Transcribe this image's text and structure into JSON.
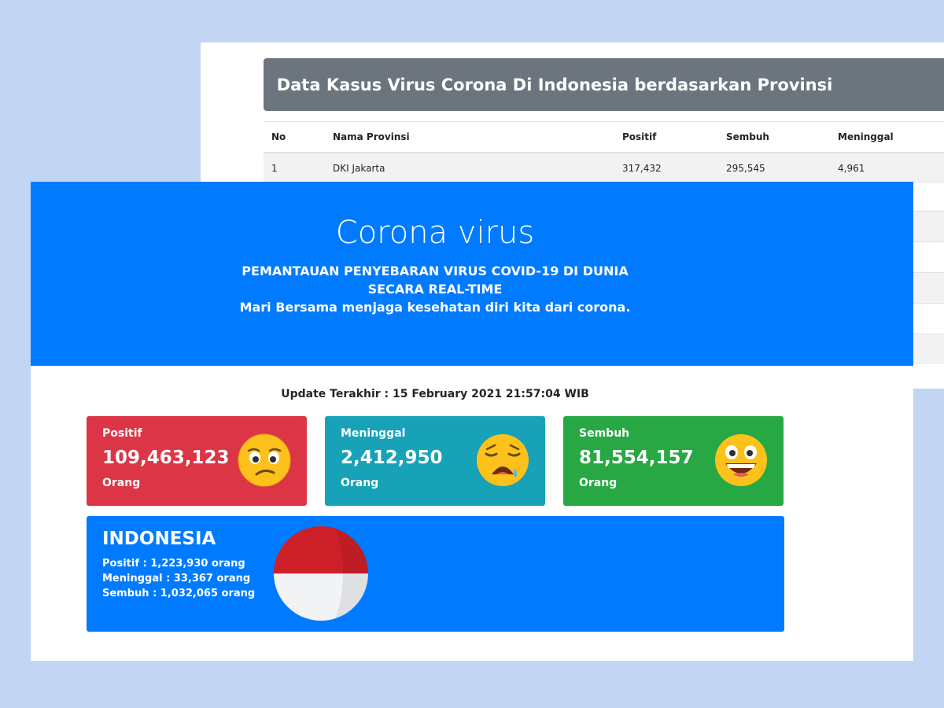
{
  "table_window": {
    "heading": "Data Kasus Virus Corona Di Indonesia berdasarkan Provinsi",
    "columns": [
      "No",
      "Nama Provinsi",
      "Positif",
      "Sembuh",
      "Meninggal"
    ],
    "rows": [
      [
        "1",
        "DKI Jakarta",
        "317,432",
        "295,545",
        "4,961"
      ]
    ]
  },
  "hero": {
    "title": "Corona virus",
    "subtitle_line1": "PEMANTAUAN PENYEBARAN VIRUS COVID-19 DI DUNIA",
    "subtitle_line2": "SECARA REAL-TIME",
    "subtitle_line3": "Mari Bersama menjaga kesehatan diri kita dari corona."
  },
  "update": "Update Terakhir : 15 February 2021 21:57:04 WIB",
  "cards": [
    {
      "label": "Positif",
      "value": "109,463,123",
      "unit": "Orang",
      "color": "#dc3545",
      "icon": "worried-face-icon"
    },
    {
      "label": "Meninggal",
      "value": "2,412,950",
      "unit": "Orang",
      "color": "#17a2b8",
      "icon": "crying-face-icon"
    },
    {
      "label": "Sembuh",
      "value": "81,554,157",
      "unit": "Orang",
      "color": "#28a745",
      "icon": "grinning-face-icon"
    }
  ],
  "indonesia": {
    "title": "INDONESIA",
    "positif": "Positif : 1,223,930 orang",
    "meninggal": "Meninggal : 33,367 orang",
    "sembuh": "Sembuh : 1,032,065 orang",
    "color": "#007bff",
    "icon": "indonesia-flag-icon"
  }
}
